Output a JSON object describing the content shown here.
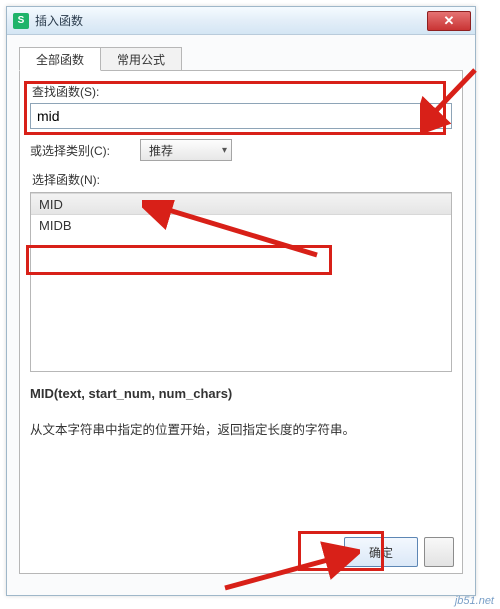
{
  "window": {
    "title": "插入函数",
    "app_icon_glyph": "S"
  },
  "tabs": [
    {
      "label": "全部函数",
      "active": true
    },
    {
      "label": "常用公式",
      "active": false
    }
  ],
  "search": {
    "label": "查找函数(S):",
    "value": "mid"
  },
  "category": {
    "label": "或选择类别(C):",
    "selected": "推荐"
  },
  "select_fn_label": "选择函数(N):",
  "functions": [
    {
      "name": "MID",
      "selected": true
    },
    {
      "name": "MIDB",
      "selected": false
    }
  ],
  "signature": "MID(text, start_num, num_chars)",
  "description": "从文本字符串中指定的位置开始，返回指定长度的字符串。",
  "buttons": {
    "ok": "确定",
    "cancel": ""
  },
  "watermark": "jb51.net",
  "accent": "#d82018"
}
